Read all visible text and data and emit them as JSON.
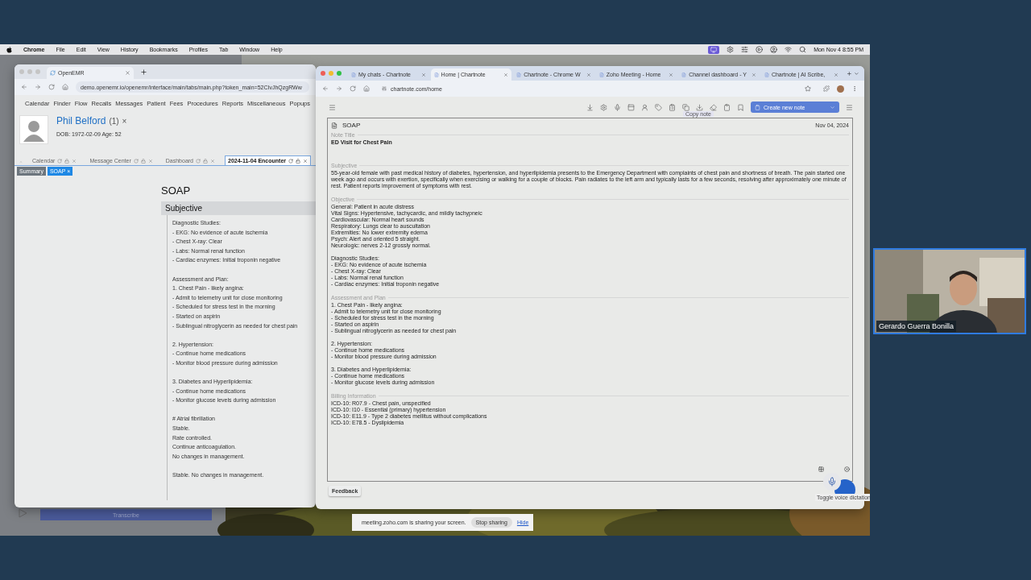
{
  "menubar": {
    "app": "Chrome",
    "menus": [
      "File",
      "Edit",
      "View",
      "History",
      "Bookmarks",
      "Profiles",
      "Tab",
      "Window",
      "Help"
    ],
    "clock": "Mon Nov 4  8:55 PM"
  },
  "back_window": {
    "button": "Transcribe"
  },
  "left_window": {
    "tabs": [
      {
        "title": "OpenEMR",
        "selected": true
      }
    ],
    "url": "demo.openemr.io/openemr/interface/main/tabs/main.php?token_main=52CIvJhQzgRWw",
    "nav": [
      "Calendar",
      "Finder",
      "Flow",
      "Recalls",
      "Messages",
      "Patient",
      "Fees",
      "Procedures",
      "Reports",
      "Miscellaneous",
      "Popups"
    ],
    "patient": {
      "name": "Phil Belford",
      "count": "(1)",
      "close": "×",
      "dob": "DOB: 1972-02-09 Age: 52"
    },
    "app_tabs": [
      {
        "label": "Calendar",
        "selected": false
      },
      {
        "label": "Message Center",
        "selected": false
      },
      {
        "label": "Dashboard",
        "selected": false
      },
      {
        "label": "2024-11-04 Encounter",
        "selected": true
      }
    ],
    "sub_tabs": [
      {
        "label": "Summary",
        "selected": false
      },
      {
        "label": "SOAP ×",
        "selected": true
      }
    ],
    "title": "SOAP",
    "section": "Subjective",
    "blocks": [
      [
        "Diagnostic Studies:",
        "- EKG: No evidence of acute ischemia",
        "- Chest X-ray: Clear",
        "- Labs: Normal renal function",
        "- Cardiac enzymes: Initial troponin negative"
      ],
      [
        "Assessment and Plan:",
        "1. Chest Pain - likely angina:",
        "- Admit to telemetry unit for close monitoring",
        "- Scheduled for stress test in the morning",
        "- Started on aspirin",
        "- Sublingual nitroglycerin as needed for chest pain"
      ],
      [
        "2. Hypertension:",
        "- Continue home medications",
        "- Monitor blood pressure during admission"
      ],
      [
        "3. Diabetes and Hyperlipidemia:",
        "- Continue home medications",
        "- Monitor glucose levels during admission"
      ],
      [
        "# Atrial fibrillation",
        "Stable.",
        "Rate controlled.",
        "Continue anticoagulation.",
        "No changes in management."
      ],
      [
        "Stable. No changes in management."
      ]
    ]
  },
  "right_window": {
    "tabs": [
      {
        "title": "My chats - Chartnote",
        "selected": false
      },
      {
        "title": "Home | Chartnote",
        "selected": true
      },
      {
        "title": "Chartnote - Chrome W",
        "selected": false
      },
      {
        "title": "Zoho Meeting - Home",
        "selected": false
      },
      {
        "title": "Channel dashboard - Y",
        "selected": false
      },
      {
        "title": "Chartnote | AI Scribe, ",
        "selected": false
      }
    ],
    "url": "chartnote.com/home",
    "create_button": "Create new note",
    "tooltip": "Copy note",
    "note": {
      "heading": "SOAP",
      "date": "Nov 04, 2024",
      "sections": [
        {
          "label": "Note Title",
          "kind": "title",
          "blocks": [
            [
              "ED Visit for Chest Pain"
            ]
          ]
        },
        {
          "label": "Subjective",
          "kind": "text",
          "blocks": [
            [
              "55-year-old female with past medical history of diabetes, hypertension, and hyperlipidemia presents to the Emergency Department with complaints of chest pain and shortness of breath. The pain started one week ago and occurs with exertion, specifically when exercising or walking for a couple of blocks. Pain radiates to the left arm and typically lasts for a few seconds, resolving after approximately one minute of rest. Patient reports improvement of symptoms with rest."
            ]
          ]
        },
        {
          "label": "Objective",
          "kind": "text",
          "blocks": [
            [
              "General: Patient in acute distress",
              "Vital Signs: Hypertensive, tachycardic, and mildly tachypneic",
              "Cardiovascular: Normal heart sounds",
              "Respiratory: Lungs clear to auscultation",
              "Extremities: No lower extremity edema",
              "Psych: Alert and oriented 5 straight.",
              "Neurologic: nerves 2-12 grossly normal."
            ],
            [
              "Diagnostic Studies:",
              "- EKG: No evidence of acute ischemia",
              "- Chest X-ray: Clear",
              "- Labs: Normal renal function",
              "- Cardiac enzymes: Initial troponin negative"
            ]
          ]
        },
        {
          "label": "Assessment and Plan",
          "kind": "text",
          "blocks": [
            [
              "1. Chest Pain - likely angina:",
              "- Admit to telemetry unit for close monitoring",
              "- Scheduled for stress test in the morning",
              "- Started on aspirin",
              "- Sublingual nitroglycerin as needed for chest pain"
            ],
            [
              "2. Hypertension:",
              "- Continue home medications",
              "- Monitor blood pressure during admission"
            ],
            [
              "3. Diabetes and Hyperlipidemia:",
              "- Continue home medications",
              "- Monitor glucose levels during admission"
            ]
          ]
        },
        {
          "label": "Billing Information",
          "kind": "text",
          "blocks": [
            [
              "ICD-10: R07.9 - Chest pain, unspecified",
              "ICD-10: I10 - Essential (primary) hypertension",
              "ICD-10: E11.9 - Type 2 diabetes mellitus without complications",
              "ICD-10: E78.5 - Dyslipidemia"
            ]
          ]
        }
      ]
    },
    "feedback": "Feedback",
    "dictation_tooltip": "Toggle voice dictation"
  },
  "video": {
    "name": "Gerardo Guerra Bonilla"
  },
  "share_bar": {
    "message": "meeting.zoho.com is sharing your screen.",
    "stop": "Stop sharing",
    "hide": "Hide"
  }
}
